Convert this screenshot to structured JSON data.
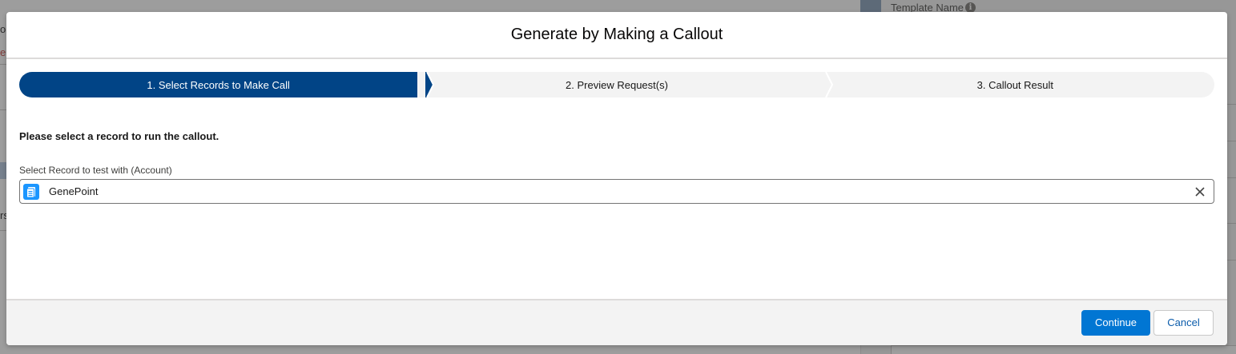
{
  "background": {
    "template_label": "Template Name",
    "left_fragments": [
      "o",
      "e t",
      "rs"
    ]
  },
  "modal": {
    "title": "Generate by Making a Callout",
    "path": [
      {
        "label": "1. Select Records to Make Call",
        "active": true
      },
      {
        "label": "2. Preview Request(s)",
        "active": false
      },
      {
        "label": "3. Callout Result",
        "active": false
      }
    ],
    "instruction": "Please select a record to run the callout.",
    "field": {
      "label": "Select Record to test with (Account)",
      "value": "GenePoint",
      "icon": "account-icon"
    },
    "footer": {
      "continue_label": "Continue",
      "cancel_label": "Cancel"
    }
  },
  "colors": {
    "active_step": "#014486",
    "brand_button": "#0176d3",
    "lookup_icon": "#1b96ff"
  }
}
